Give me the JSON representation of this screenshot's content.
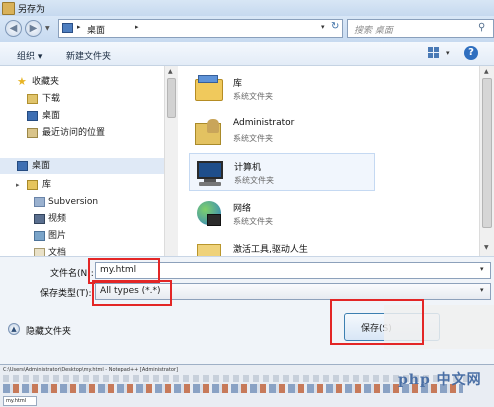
{
  "window": {
    "title": "另存为"
  },
  "address": {
    "path": "桌面",
    "search_placeholder": "搜索 桌面"
  },
  "toolbar": {
    "organize": "组织 ▾",
    "new_folder": "新建文件夹"
  },
  "sidebar": {
    "favorites_header": "收藏夹",
    "favorites": [
      "下载",
      "桌面",
      "最近访问的位置"
    ],
    "desktop": "桌面",
    "library": "库",
    "library_items": [
      "Subversion",
      "视频",
      "图片",
      "文档"
    ]
  },
  "files": [
    {
      "name": "库",
      "type": "系统文件夹",
      "icon": "library-icon"
    },
    {
      "name": "Administrator",
      "type": "系统文件夹",
      "icon": "user-folder-icon"
    },
    {
      "name": "计算机",
      "type": "系统文件夹",
      "icon": "computer-icon"
    },
    {
      "name": "网络",
      "type": "系统文件夹",
      "icon": "network-icon"
    },
    {
      "name": "激活工具,驱动人生",
      "type": "",
      "icon": "folder-icon"
    }
  ],
  "form": {
    "filename_label": "文件名(N):",
    "filename_value": "my.html",
    "filetype_label": "保存类型(T):",
    "filetype_value": "All types (*.*)",
    "hide_folders": "隐藏文件夹",
    "save_button": "保存(S)"
  },
  "notepad": {
    "title": "C:\\Users\\Administrator\\Desktop\\my.html - Notepad++ [Administrator]",
    "tab": "my.html"
  },
  "watermark": "php 中文网",
  "colors": {
    "highlight_red": "#e32626",
    "accent_blue": "#3399ff"
  }
}
